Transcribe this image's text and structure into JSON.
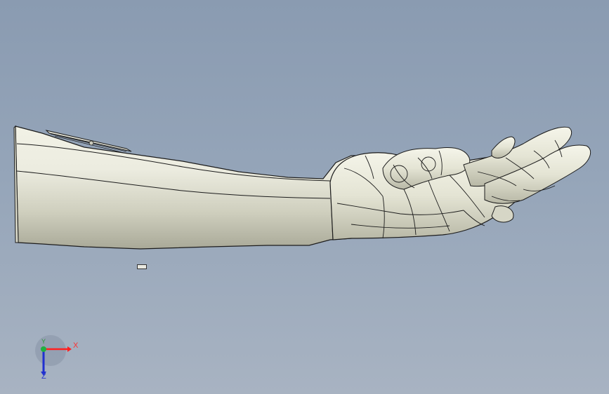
{
  "viewport": {
    "background_top": "#8a9bb1",
    "background_bottom": "#a8b3c2"
  },
  "model": {
    "icon": "robot-arm-model",
    "surface_color": "#e6e6d6",
    "edge_color": "#1c1c1c"
  },
  "triad": {
    "x_label": "X",
    "y_label": "Y",
    "z_label": "Z",
    "x_color": "#ff2020",
    "y_color": "#20b040",
    "z_color": "#2030d0"
  }
}
